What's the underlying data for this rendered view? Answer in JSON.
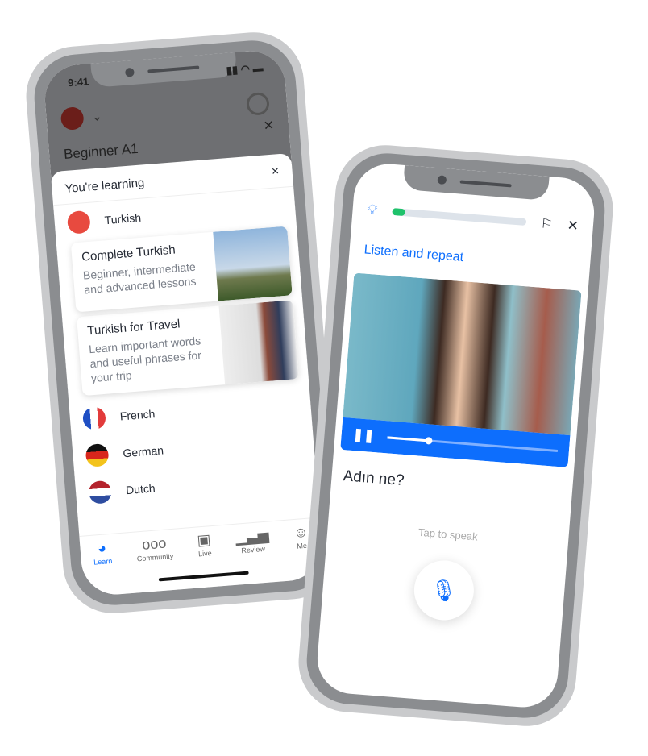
{
  "left_phone": {
    "status_time": "9:41",
    "background_title": "Beginner A1",
    "sheet_title": "You're learning",
    "languages": [
      {
        "name": "Turkish",
        "flag": "turkey-flag-icon"
      },
      {
        "name": "French",
        "flag": "france-flag-icon"
      },
      {
        "name": "German",
        "flag": "germany-flag-icon"
      },
      {
        "name": "Dutch",
        "flag": "netherlands-flag-icon"
      }
    ],
    "courses": [
      {
        "title": "Complete Turkish",
        "desc": "Beginner, intermediate and advanced lessons"
      },
      {
        "title": "Turkish for Travel",
        "desc": "Learn important words and useful phrases for your trip"
      }
    ],
    "nav": [
      {
        "label": "Learn",
        "active": true
      },
      {
        "label": "Community"
      },
      {
        "label": "Live"
      },
      {
        "label": "Review"
      },
      {
        "label": "Me"
      }
    ]
  },
  "right_phone": {
    "progress": 0.1,
    "instruction": "Listen and repeat",
    "video_progress": 0.24,
    "phrase": "Adın ne?",
    "tap_hint": "Tap to speak"
  },
  "colors": {
    "accent": "#0d6efd",
    "progress_green": "#1fc26b",
    "turkey_red": "#e30a17"
  }
}
